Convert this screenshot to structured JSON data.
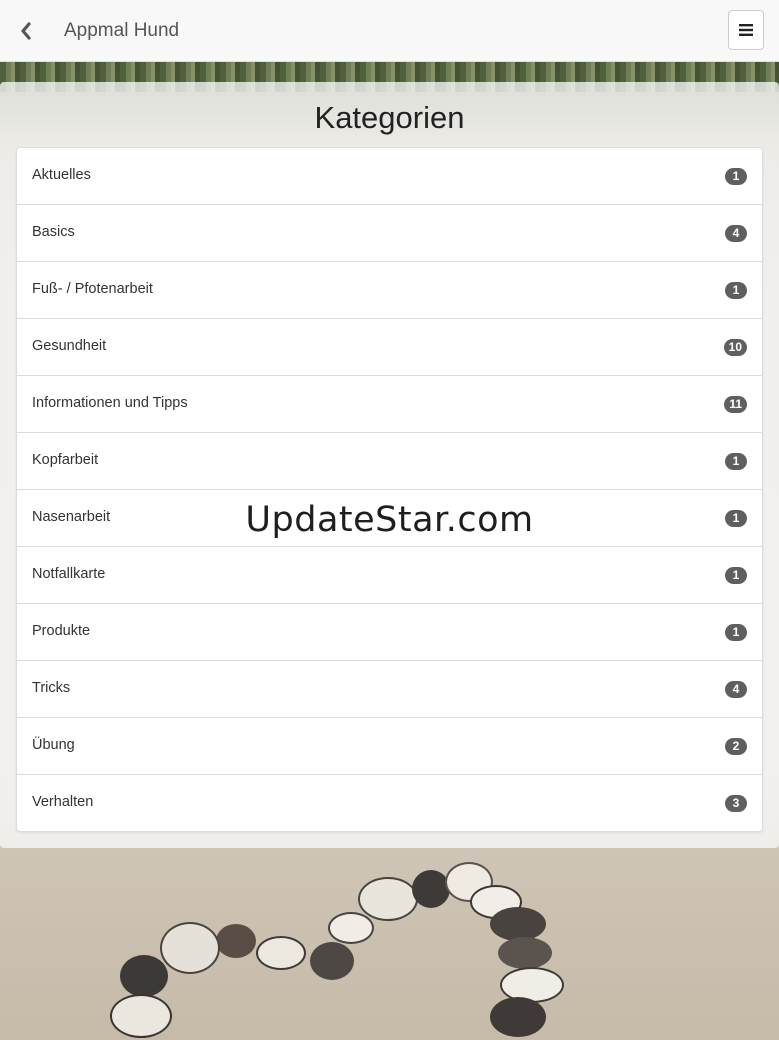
{
  "header": {
    "back_icon": "chevron-left-icon",
    "title": "Appmal Hund",
    "menu_icon": "hamburger-menu-icon"
  },
  "main": {
    "title": "Kategorien",
    "categories": [
      {
        "label": "Aktuelles",
        "count": "1"
      },
      {
        "label": "Basics",
        "count": "4"
      },
      {
        "label": "Fuß- / Pfotenarbeit",
        "count": "1"
      },
      {
        "label": "Gesundheit",
        "count": "10"
      },
      {
        "label": "Informationen und Tipps",
        "count": "11"
      },
      {
        "label": "Kopfarbeit",
        "count": "1"
      },
      {
        "label": "Nasenarbeit",
        "count": "1"
      },
      {
        "label": "Notfallkarte",
        "count": "1"
      },
      {
        "label": "Produkte",
        "count": "1"
      },
      {
        "label": "Tricks",
        "count": "4"
      },
      {
        "label": "Übung",
        "count": "2"
      },
      {
        "label": "Verhalten",
        "count": "3"
      }
    ]
  },
  "watermark": "UpdateStar.com"
}
